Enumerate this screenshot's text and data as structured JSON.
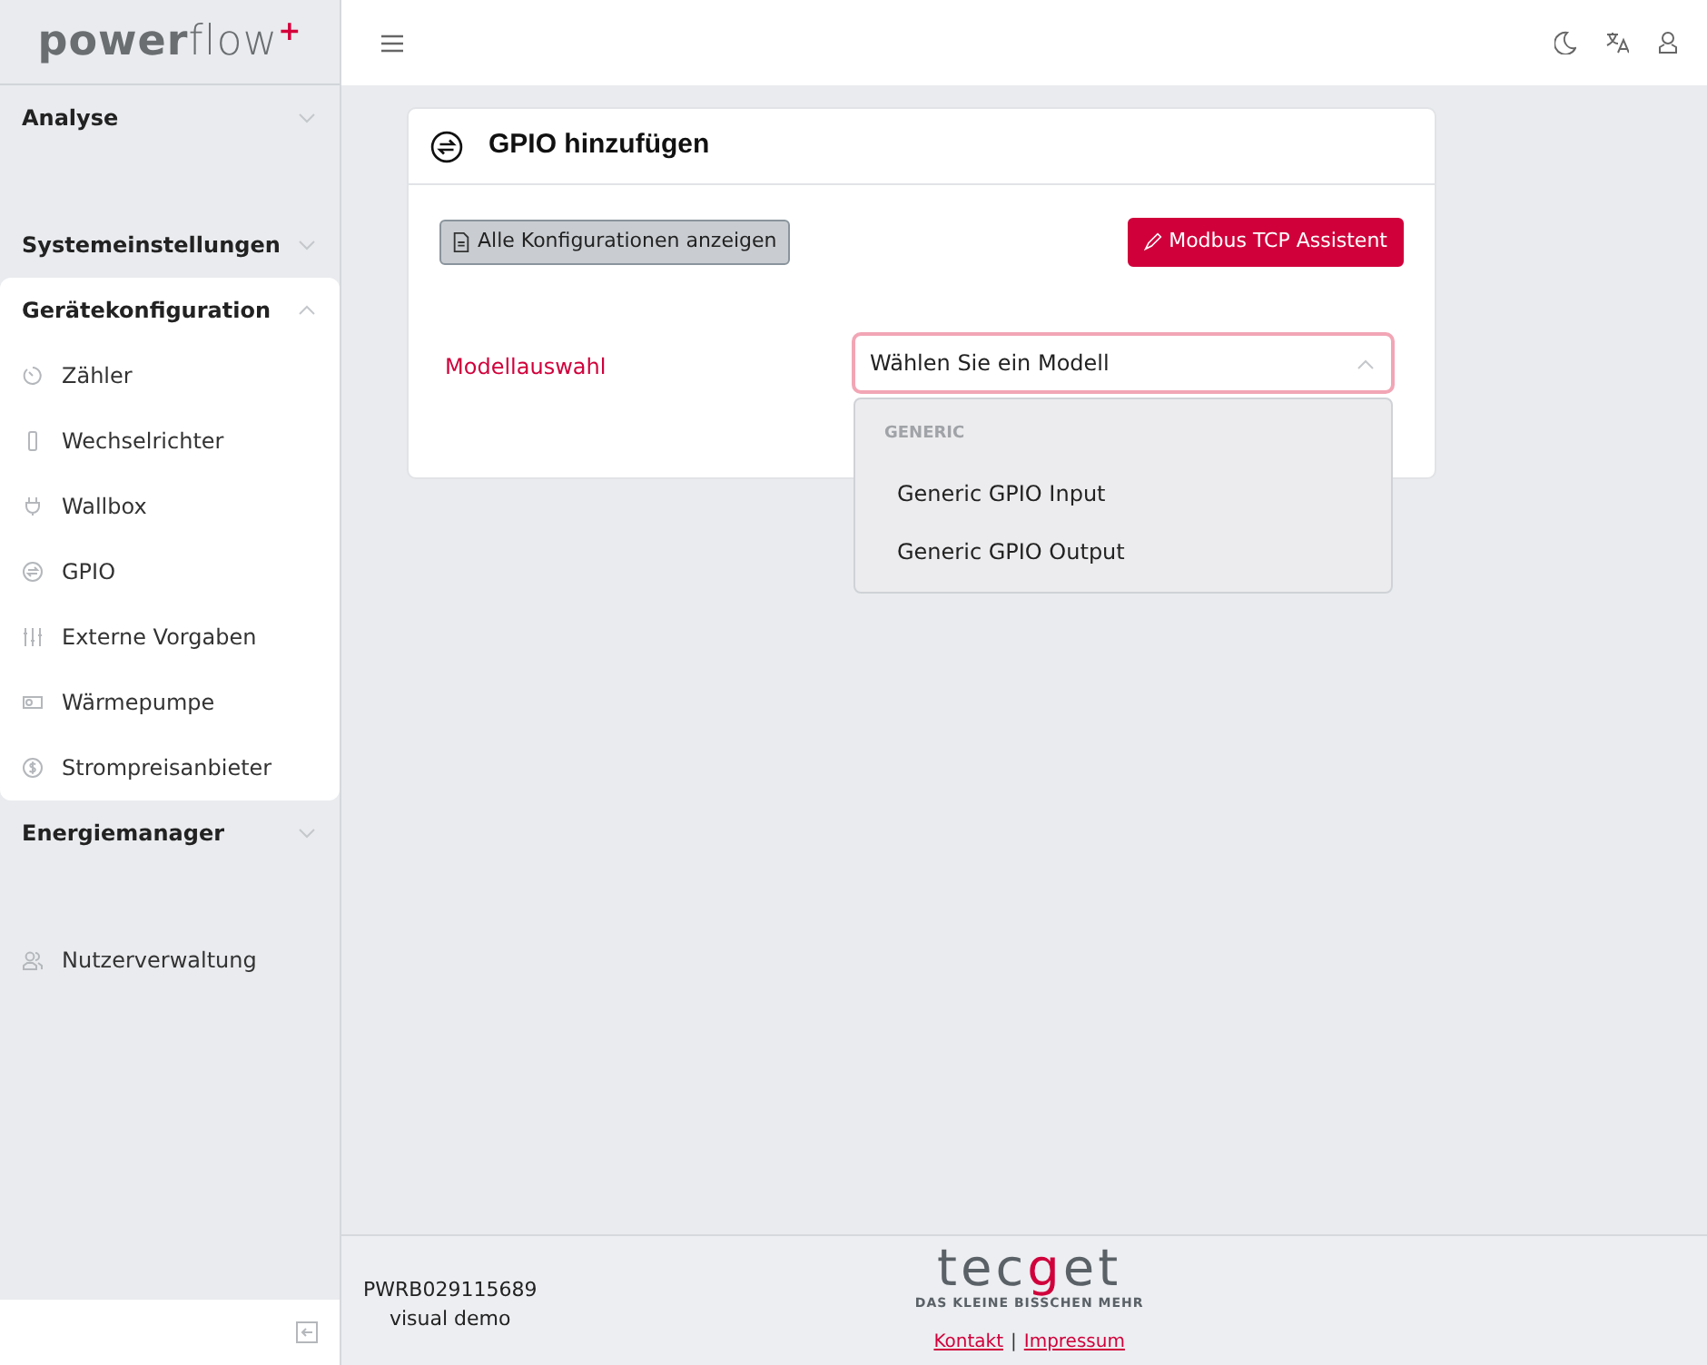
{
  "brand": {
    "strong": "power",
    "light": "flow",
    "mark": "+"
  },
  "sidebar": [
    {
      "kind": "section",
      "label": "Analyse",
      "expanded": false
    },
    {
      "kind": "section",
      "label": "Systemeinstellungen",
      "expanded": false
    },
    {
      "kind": "section",
      "label": "Gerätekonfiguration",
      "expanded": true,
      "children": [
        {
          "label": "Zähler"
        },
        {
          "label": "Wechselrichter"
        },
        {
          "label": "Wallbox"
        },
        {
          "label": "GPIO"
        },
        {
          "label": "Externe Vorgaben"
        },
        {
          "label": "Wärmepumpe"
        },
        {
          "label": "Strompreisanbieter"
        }
      ]
    },
    {
      "kind": "section",
      "label": "Energiemanager",
      "expanded": false
    },
    {
      "kind": "link",
      "label": "Nutzerverwaltung"
    }
  ],
  "card": {
    "title": "GPIO hinzufügen",
    "buttons": [
      {
        "label": "Alle Konfigurationen anzeigen",
        "kind": "secondary"
      },
      {
        "label": "Modbus TCP Assistent",
        "kind": "danger"
      }
    ],
    "field": {
      "label": "Modellauswahl",
      "placeholder": "Wählen Sie ein Modell",
      "expanded": true,
      "groups": [
        {
          "label": "GENERIC",
          "options": [
            "Generic GPIO Input",
            "Generic GPIO Output"
          ]
        }
      ]
    }
  },
  "footer": {
    "serial": "PWRB029115689",
    "mode": "visual demo",
    "logo": {
      "start": "tec",
      "accent": "g",
      "end": "et",
      "tagline": "DAS KLEINE BISSCHEN MEHR"
    },
    "links": [
      "Kontakt",
      "Impressum"
    ],
    "separator": "|"
  }
}
